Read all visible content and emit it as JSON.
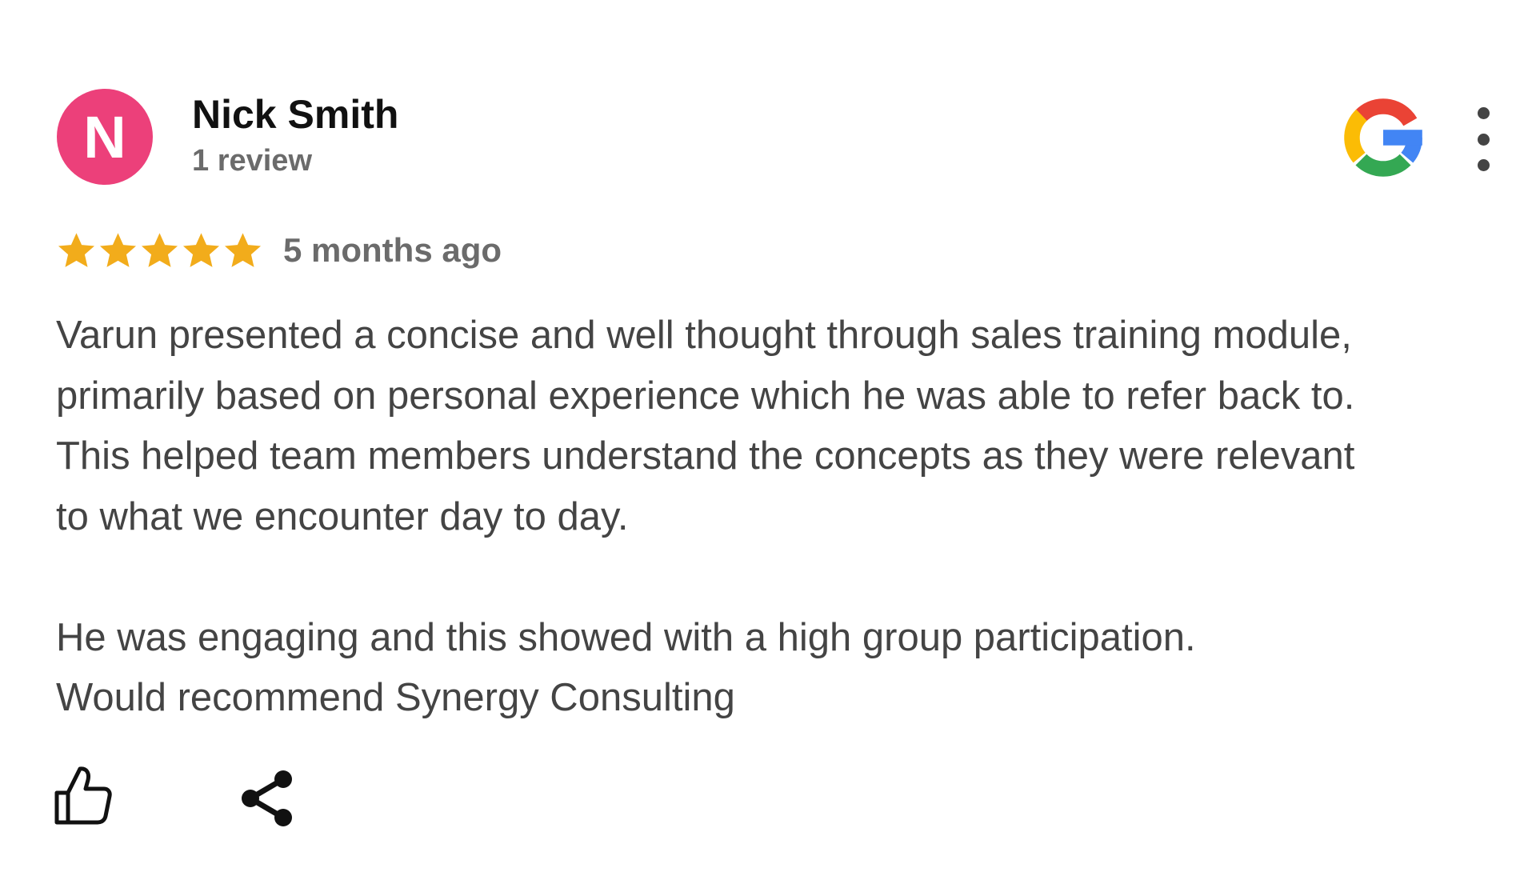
{
  "review": {
    "author": {
      "initial": "N",
      "name": "Nick Smith",
      "review_count": "1 review",
      "avatar_color": "#ec407a"
    },
    "source": {
      "logo_icon": "google-g-icon"
    },
    "menu_icon": "more-vert-icon",
    "rating": {
      "stars": 5,
      "max_stars": 5,
      "star_color": "#f2ac1b",
      "date": "5 months ago"
    },
    "body": {
      "line_1": "Varun presented a concise and well thought through sales training module,",
      "line_2": "primarily based on personal experience which he was able to refer back to.",
      "line_3": "This helped team members understand the concepts as they were relevant",
      "line_4": "to what we encounter day to day.",
      "line_5": "He was engaging and this showed with a high group participation.",
      "line_6": "Would recommend Synergy Consulting"
    },
    "actions": {
      "like_icon": "thumbs-up-icon",
      "share_icon": "share-icon"
    }
  }
}
